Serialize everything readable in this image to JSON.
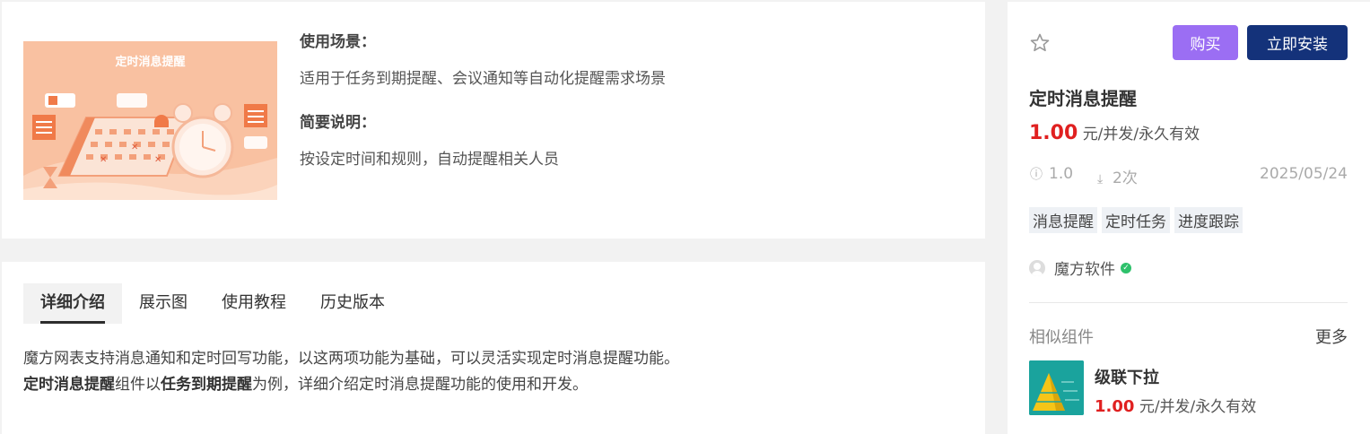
{
  "intro": {
    "cover_title": "定时消息提醒",
    "scenario_heading": "使用场景：",
    "scenario_text": "适用于任务到期提醒、会议通知等自动化提醒需求场景",
    "summary_heading": "简要说明：",
    "summary_text": "按设定时间和规则，自动提醒相关人员"
  },
  "tabs": [
    {
      "label": "详细介绍",
      "active": true
    },
    {
      "label": "展示图",
      "active": false
    },
    {
      "label": "使用教程",
      "active": false
    },
    {
      "label": "历史版本",
      "active": false
    }
  ],
  "description": {
    "line1": "魔方网表支持消息通知和定时回写功能，以这两项功能为基础，可以灵活实现定时消息提醒功能。",
    "line2_bold1": "定时消息提醒",
    "line2_text1": "组件以",
    "line2_bold2": "任务到期提醒",
    "line2_text2": "为例，详细介绍定时消息提醒功能的使用和开发。"
  },
  "product": {
    "buy_label": "购买",
    "install_label": "立即安装",
    "title": "定时消息提醒",
    "price_value": "1.00",
    "price_unit": "元/并发/永久有效",
    "version": "1.0",
    "downloads": "2次",
    "date": "2025/05/24",
    "tags": [
      "消息提醒",
      "定时任务",
      "进度跟踪"
    ],
    "vendor": "魔方软件"
  },
  "similar": {
    "heading": "相似组件",
    "more_label": "更多",
    "items": [
      {
        "title": "级联下拉",
        "price_value": "1.00",
        "price_unit": "元/并发/永久有效"
      }
    ]
  },
  "colors": {
    "accent_buy": "#9b6ef3",
    "accent_install": "#14327a",
    "price": "#e02020",
    "cover_bg": "#f9c1a1"
  }
}
